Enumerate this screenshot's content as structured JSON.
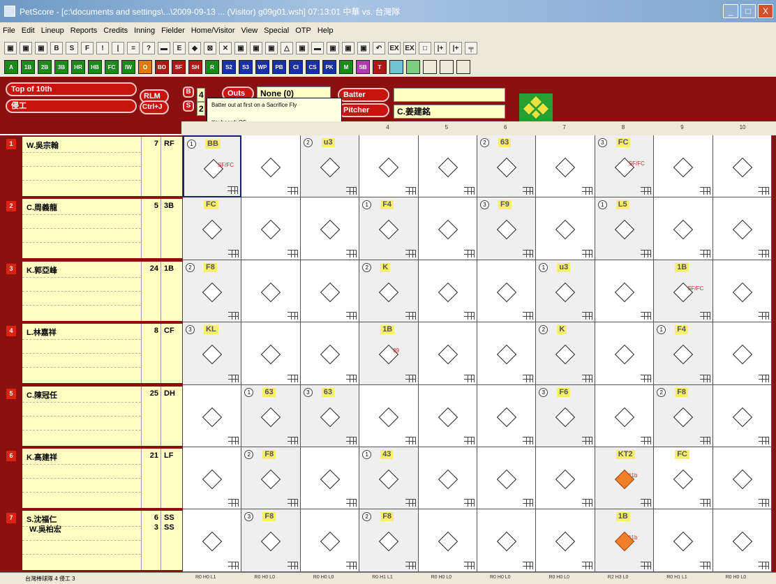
{
  "window": {
    "title": "PetScore - [c:\\documents and settings\\...\\2009-09-13 ... (Visitor) g09g01.wsh]   07:13:01   中華 vs. 台灣隊",
    "buttons": [
      "_",
      "□",
      "X"
    ]
  },
  "menu": [
    "File",
    "Edit",
    "Lineup",
    "Reports",
    "Credits",
    "Inning",
    "Fielder",
    "Home/Visitor",
    "View",
    "Special",
    "OTP",
    "Help"
  ],
  "toolbar1": [
    "▣",
    "▣",
    "▣",
    "B",
    "S",
    "F",
    "!",
    "|",
    "=",
    "?",
    "▬",
    "E",
    "◆",
    "⊠",
    "✕",
    "▣",
    "▣",
    "▣",
    "△",
    "▣",
    "▬",
    "▣",
    "▣",
    "▣",
    "↶",
    "EX",
    "EX",
    "□",
    "|+",
    "|+",
    "╤"
  ],
  "toolbar2": [
    {
      "label": "A",
      "color": "#1a8a1a"
    },
    {
      "label": "1B",
      "color": "#1a8a1a"
    },
    {
      "label": "2B",
      "color": "#1a8a1a"
    },
    {
      "label": "3B",
      "color": "#1a8a1a"
    },
    {
      "label": "HR",
      "color": "#1a8a1a"
    },
    {
      "label": "HB",
      "color": "#1a8a1a"
    },
    {
      "label": "FC",
      "color": "#1a8a1a"
    },
    {
      "label": "IW",
      "color": "#1a8a1a"
    },
    {
      "label": "O",
      "color": "#e07a10"
    },
    {
      "label": "BO",
      "color": "#b01818"
    },
    {
      "label": "SF",
      "color": "#b01818"
    },
    {
      "label": "SH",
      "color": "#b01818"
    },
    {
      "label": "R",
      "color": "#1a8a1a"
    },
    {
      "label": "S2",
      "color": "#1830a8"
    },
    {
      "label": "S3",
      "color": "#1830a8"
    },
    {
      "label": "WP",
      "color": "#1830a8"
    },
    {
      "label": "PB",
      "color": "#1830a8"
    },
    {
      "label": "CI",
      "color": "#1830a8"
    },
    {
      "label": "CS",
      "color": "#1830a8"
    },
    {
      "label": "PK",
      "color": "#1830a8"
    },
    {
      "label": "M",
      "color": "#1a8a1a"
    },
    {
      "label": "SB",
      "color": "#b03ab0"
    },
    {
      "label": "T",
      "color": "#b01818"
    },
    {
      "label": "",
      "color": "#6fc6d0"
    },
    {
      "label": "",
      "color": "#7fce7f"
    },
    {
      "label": "",
      "color": "#ece9d8"
    },
    {
      "label": "",
      "color": "#ece9d8"
    },
    {
      "label": "",
      "color": "#ece9d8"
    }
  ],
  "info": {
    "inning": "Top of 10th",
    "team": "侵工",
    "rlm": "RLM",
    "ctrlj": "Ctrl+J",
    "b_label": "B",
    "s_label": "S",
    "balls": "4",
    "strikes": "2",
    "outs_label": "Outs",
    "pitch_box": "None (0)",
    "batter_label": "Batter",
    "pitcher_label": "Pitcher",
    "batter_value": "",
    "pitcher_value": "C.姜建銘"
  },
  "tooltip": {
    "line1": "Batter out at first on a Sacrifice Fly",
    "line2": "Keyboard: OS"
  },
  "columns": [
    "",
    "",
    "",
    "4",
    "5",
    "6",
    "7",
    "8",
    "9",
    "10"
  ],
  "lineup": [
    {
      "order": "1",
      "name": "W.吳宗翰",
      "no": "7",
      "pos": "RF"
    },
    {
      "order": "2",
      "name": "C.周義龍",
      "no": "5",
      "pos": "3B"
    },
    {
      "order": "3",
      "name": "K.郭亞峰",
      "no": "24",
      "pos": "1B"
    },
    {
      "order": "4",
      "name": "L.林嘉祥",
      "no": "8",
      "pos": "CF"
    },
    {
      "order": "5",
      "name": "C.陳冠任",
      "no": "25",
      "pos": "DH"
    },
    {
      "order": "6",
      "name": "K.高建祥",
      "no": "21",
      "pos": "LF"
    },
    {
      "order": "7",
      "name": "S.沈福仁",
      "no": "6",
      "pos": "SS",
      "name2": "W.吳柏宏",
      "no2": "3",
      "pos2": "SS"
    }
  ],
  "grid": [
    [
      {
        "r": "BB",
        "o": "1",
        "sh": true,
        "sel": true,
        "ann": "SF/FC"
      },
      {
        "r": ""
      },
      {
        "r": "u3",
        "o": "2",
        "sh": true
      },
      {
        "r": ""
      },
      {
        "r": ""
      },
      {
        "r": "63",
        "o": "2",
        "sh": true
      },
      {
        "r": ""
      },
      {
        "r": "FC",
        "o": "3",
        "sh": true,
        "ann": "SF/FC"
      },
      {
        "r": ""
      },
      {
        "r": ""
      }
    ],
    [
      {
        "r": "FC",
        "sh": true
      },
      {
        "r": ""
      },
      {
        "r": ""
      },
      {
        "r": "F4",
        "o": "1",
        "sh": true
      },
      {
        "r": ""
      },
      {
        "r": "F9",
        "o": "3",
        "sh": true
      },
      {
        "r": ""
      },
      {
        "r": "L5",
        "o": "1",
        "sh": true
      },
      {
        "r": ""
      },
      {
        "r": ""
      }
    ],
    [
      {
        "r": "F8",
        "o": "2",
        "sh": true
      },
      {
        "r": ""
      },
      {
        "r": ""
      },
      {
        "r": "K",
        "o": "2",
        "sh": true
      },
      {
        "r": ""
      },
      {
        "r": ""
      },
      {
        "r": "u3",
        "o": "1",
        "sh": true
      },
      {
        "r": ""
      },
      {
        "r": "1B",
        "sh": true,
        "ann": "SF/FC"
      },
      {
        "r": ""
      }
    ],
    [
      {
        "r": "KL",
        "o": "3",
        "sh": true
      },
      {
        "r": ""
      },
      {
        "r": ""
      },
      {
        "r": "1B",
        "sh": true,
        "ann": "89"
      },
      {
        "r": ""
      },
      {
        "r": ""
      },
      {
        "r": "K",
        "o": "2",
        "sh": true
      },
      {
        "r": ""
      },
      {
        "r": "F4",
        "o": "1",
        "sh": true
      },
      {
        "r": ""
      }
    ],
    [
      {
        "r": ""
      },
      {
        "r": "63",
        "o": "1",
        "sh": true
      },
      {
        "r": "63",
        "o": "3",
        "sh": true
      },
      {
        "r": ""
      },
      {
        "r": ""
      },
      {
        "r": ""
      },
      {
        "r": "F6",
        "o": "3",
        "sh": true
      },
      {
        "r": ""
      },
      {
        "r": "F8",
        "o": "2",
        "sh": true
      },
      {
        "r": ""
      }
    ],
    [
      {
        "r": ""
      },
      {
        "r": "F8",
        "o": "2",
        "sh": true
      },
      {
        "r": ""
      },
      {
        "r": "43",
        "o": "1",
        "sh": true
      },
      {
        "r": ""
      },
      {
        "r": ""
      },
      {
        "r": ""
      },
      {
        "r": "KT2",
        "sh": true,
        "run": true,
        "ann": "^1b"
      },
      {
        "r": "FC"
      },
      {
        "r": ""
      }
    ],
    [
      {
        "r": ""
      },
      {
        "r": "F8",
        "o": "3",
        "sh": true
      },
      {
        "r": ""
      },
      {
        "r": "F8",
        "o": "2",
        "sh": true
      },
      {
        "r": ""
      },
      {
        "r": ""
      },
      {
        "r": ""
      },
      {
        "r": "1B",
        "sh": true,
        "run": true,
        "ann": "^1b"
      },
      {
        "r": ""
      },
      {
        "r": ""
      }
    ]
  ],
  "status": {
    "left": "台灣棒球隊 4  侵工 3",
    "foot": [
      "R0 H0 L1",
      "R0 H0 L0",
      "R0 H0 L0",
      "R0 H1 L1",
      "R0 H0 L0",
      "R0 H0 L0",
      "R0 H0 L0",
      "R2 H3 L0",
      "R0 H1 L1",
      "R0 H0 L0"
    ]
  }
}
